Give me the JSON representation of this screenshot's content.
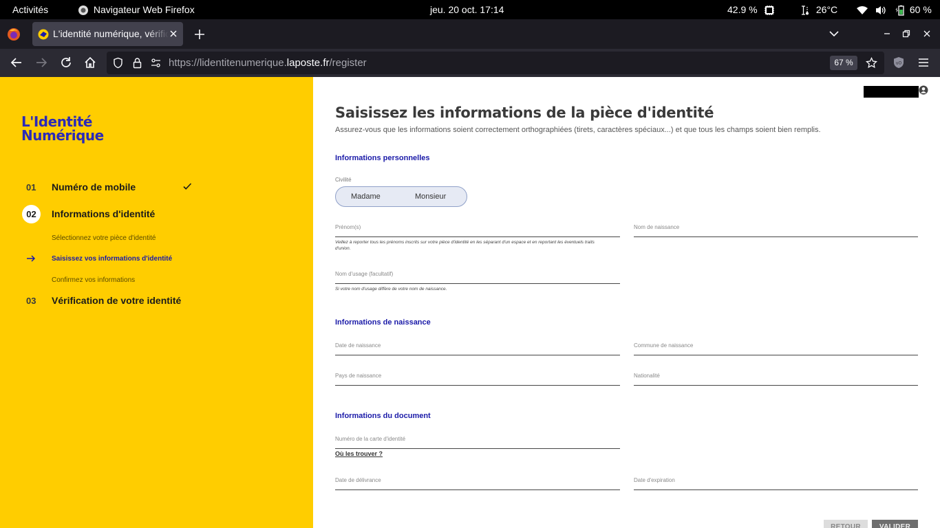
{
  "system_bar": {
    "activities": "Activités",
    "app_name": "Navigateur Web Firefox",
    "datetime": "jeu. 20 oct.  17:14",
    "cpu": "42.9 %",
    "temperature": "26°C",
    "battery": "60 %"
  },
  "browser": {
    "tab_title": "L'identité numérique, vérification",
    "url_base": "https://lidentitenumerique.",
    "url_domain": "laposte.fr",
    "url_path": "/register",
    "zoom": "67 %"
  },
  "sidebar": {
    "logo_line1": "L'Identité",
    "logo_line2": "Numérique",
    "steps": [
      {
        "num": "01",
        "title": "Numéro de mobile"
      },
      {
        "num": "02",
        "title": "Informations d'identité"
      },
      {
        "num": "03",
        "title": "Vérification de votre identité"
      }
    ],
    "substeps": [
      "Sélectionnez votre pièce d'identité",
      "Saisissez vos informations d'identité",
      "Confirmez vos informations"
    ]
  },
  "form": {
    "title": "Saisissez les informations de la pièce d'identité",
    "subtitle": "Assurez-vous que les informations soient correctement orthographiées (tirets, caractères spéciaux...) et que tous les champs soient bien remplis.",
    "section_personal": "Informations personnelles",
    "civility_label": "Civilité",
    "civility_options": [
      "Madame",
      "Monsieur"
    ],
    "first_names_label": "Prénom(s)",
    "first_names_hint": "Veillez à reporter tous les prénoms inscrits sur votre pièce d'identité en les séparant d'un espace et en reportant les éventuels traits d'union.",
    "birth_name_label": "Nom de naissance",
    "usage_name_label": "Nom d'usage (facultatif)",
    "usage_name_hint": "Si votre nom d'usage diffère de votre nom de naissance.",
    "section_birth": "Informations de naissance",
    "birth_date_label": "Date de naissance",
    "birth_city_label": "Commune de naissance",
    "birth_country_label": "Pays de naissance",
    "nationality_label": "Nationalité",
    "section_document": "Informations du document",
    "id_number_label": "Numéro de la carte d'identité",
    "where_link": "Où les trouver ?",
    "issue_date_label": "Date de délivrance",
    "expiry_date_label": "Date d'expiration",
    "back_button": "RETOUR",
    "submit_button": "VALIDER"
  },
  "colors": {
    "sidebar_bg": "#ffcd00",
    "accent_blue": "#1a1aa8"
  }
}
